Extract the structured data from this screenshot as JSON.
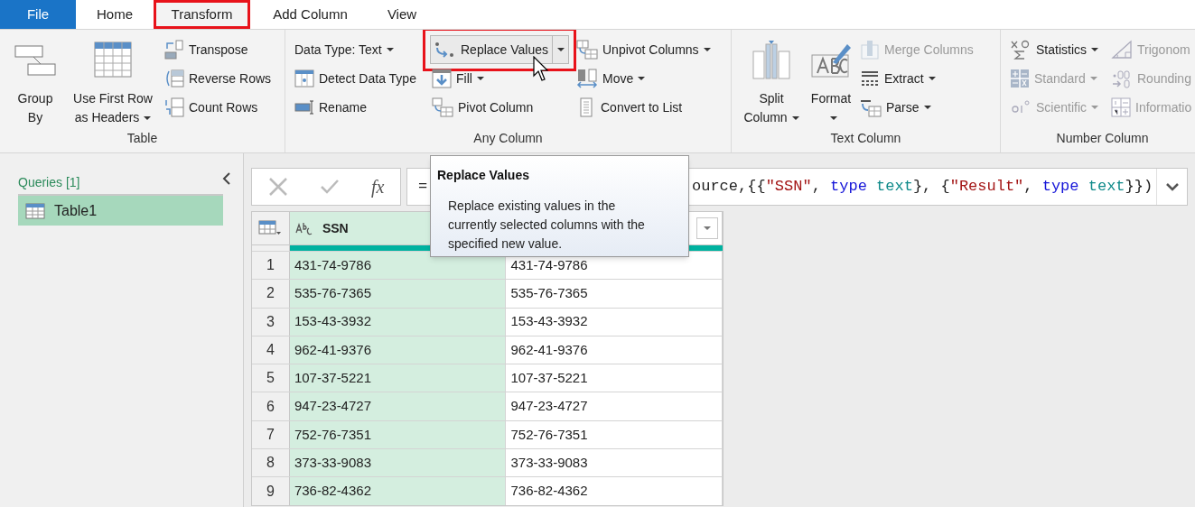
{
  "tabs": [
    {
      "label": "File",
      "kind": "backstage",
      "selected": false,
      "highlighted": false
    },
    {
      "label": "Home",
      "kind": "tab",
      "selected": false,
      "highlighted": false
    },
    {
      "label": "Transform",
      "kind": "tab",
      "selected": true,
      "highlighted": true
    },
    {
      "label": "Add Column",
      "kind": "tab",
      "selected": false,
      "highlighted": false
    },
    {
      "label": "View",
      "kind": "tab",
      "selected": false,
      "highlighted": false
    }
  ],
  "ribbon": {
    "groups": [
      {
        "name": "Table",
        "columns": [
          {
            "kind": "large",
            "items": [
              {
                "label": "Group By",
                "dropdown": false,
                "disabled": false
              }
            ]
          },
          {
            "kind": "large",
            "items": [
              {
                "label": "Use First Row as Headers",
                "dropdown": true,
                "disabled": false
              }
            ]
          },
          {
            "kind": "stack",
            "items": [
              {
                "label": "Transpose",
                "dropdown": false,
                "disabled": false
              },
              {
                "label": "Reverse Rows",
                "dropdown": false,
                "disabled": false
              },
              {
                "label": "Count Rows",
                "dropdown": false,
                "disabled": false
              }
            ]
          }
        ]
      },
      {
        "name": "Any Column",
        "columns": [
          {
            "kind": "stack",
            "items": [
              {
                "label": "Data Type: Text",
                "dropdown": true,
                "disabled": false
              },
              {
                "label": "Detect Data Type",
                "dropdown": false,
                "disabled": false
              },
              {
                "label": "Rename",
                "dropdown": false,
                "disabled": false
              }
            ]
          },
          {
            "kind": "stack",
            "items": [
              {
                "label": "Replace Values",
                "dropdown": true,
                "disabled": false,
                "hovered": true,
                "highlighted": true
              },
              {
                "label": "Fill",
                "dropdown": true,
                "disabled": false
              },
              {
                "label": "Pivot Column",
                "dropdown": false,
                "disabled": false
              }
            ]
          },
          {
            "kind": "stack",
            "items": [
              {
                "label": "Unpivot Columns",
                "dropdown": true,
                "disabled": false
              },
              {
                "label": "Move",
                "dropdown": true,
                "disabled": false
              },
              {
                "label": "Convert to List",
                "dropdown": false,
                "disabled": false
              }
            ]
          }
        ]
      },
      {
        "name": "Text Column",
        "columns": [
          {
            "kind": "large",
            "items": [
              {
                "label": "Split Column",
                "dropdown": true,
                "disabled": false
              }
            ]
          },
          {
            "kind": "large",
            "items": [
              {
                "label": "Format",
                "dropdown": true,
                "disabled": false
              }
            ]
          },
          {
            "kind": "stack",
            "items": [
              {
                "label": "Merge Columns",
                "dropdown": false,
                "disabled": true
              },
              {
                "label": "Extract",
                "dropdown": true,
                "disabled": false
              },
              {
                "label": "Parse",
                "dropdown": true,
                "disabled": false
              }
            ]
          }
        ]
      },
      {
        "name": "Number Column",
        "columns": [
          {
            "kind": "stack",
            "items": [
              {
                "label": "Statistics",
                "dropdown": true,
                "disabled": false
              },
              {
                "label": "Standard",
                "dropdown": true,
                "disabled": true
              },
              {
                "label": "Scientific",
                "dropdown": true,
                "disabled": true
              }
            ]
          },
          {
            "kind": "stack",
            "items": [
              {
                "label": "Trigonom",
                "disabled": true
              },
              {
                "label": "Rounding",
                "disabled": true
              },
              {
                "label": "Informatio",
                "disabled": true
              }
            ]
          }
        ]
      }
    ]
  },
  "queries": {
    "title": "Queries [1]",
    "items": [
      {
        "label": "Table1",
        "selected": true
      }
    ]
  },
  "formula_bar": {
    "fx": "fx",
    "prefix": "=",
    "tokens": [
      {
        "text": "ource,{{",
        "kind": "plain"
      },
      {
        "text": "\"SSN\"",
        "kind": "string"
      },
      {
        "text": ", ",
        "kind": "plain"
      },
      {
        "text": "type",
        "kind": "keyword"
      },
      {
        "text": " text",
        "kind": "type"
      },
      {
        "text": "}, {",
        "kind": "plain"
      },
      {
        "text": "\"Result\"",
        "kind": "string"
      },
      {
        "text": ", ",
        "kind": "plain"
      },
      {
        "text": "type",
        "kind": "keyword"
      },
      {
        "text": " text",
        "kind": "type"
      },
      {
        "text": "}})",
        "kind": "plain"
      }
    ]
  },
  "table": {
    "columns": [
      {
        "label": "SSN",
        "selected": true
      },
      {
        "selected": false
      }
    ],
    "rows": [
      {
        "index": "1",
        "cells": [
          "431-74-9786",
          "431-74-9786"
        ]
      },
      {
        "index": "2",
        "cells": [
          "535-76-7365",
          "535-76-7365"
        ]
      },
      {
        "index": "3",
        "cells": [
          "153-43-3932",
          "153-43-3932"
        ]
      },
      {
        "index": "4",
        "cells": [
          "962-41-9376",
          "962-41-9376"
        ]
      },
      {
        "index": "5",
        "cells": [
          "107-37-5221",
          "107-37-5221"
        ]
      },
      {
        "index": "6",
        "cells": [
          "947-23-4727",
          "947-23-4727"
        ]
      },
      {
        "index": "7",
        "cells": [
          "752-76-7351",
          "752-76-7351"
        ]
      },
      {
        "index": "8",
        "cells": [
          "373-33-9083",
          "373-33-9083"
        ]
      },
      {
        "index": "9",
        "cells": [
          "736-82-4362",
          "736-82-4362"
        ]
      }
    ]
  },
  "tooltip": {
    "title": "Replace Values",
    "text": "Replace existing values in the currently selected columns with the specified new value."
  }
}
